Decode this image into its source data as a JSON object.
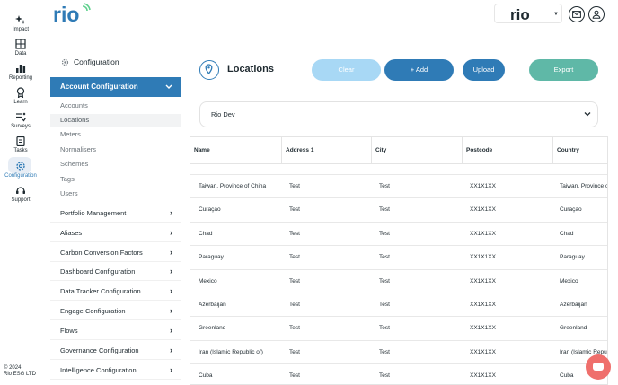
{
  "nav": {
    "items": [
      {
        "label": "Impact",
        "icon": "sparkle-icon"
      },
      {
        "label": "Data",
        "icon": "grid-icon"
      },
      {
        "label": "Reporting",
        "icon": "bar-chart-icon"
      },
      {
        "label": "Learn",
        "icon": "award-icon"
      },
      {
        "label": "Surveys",
        "icon": "list-check-icon"
      },
      {
        "label": "Tasks",
        "icon": "clipboard-icon"
      },
      {
        "label": "Configuration",
        "icon": "gear-icon",
        "active": true
      },
      {
        "label": "Support",
        "icon": "headset-icon"
      }
    ],
    "footer_line1": "© 2024",
    "footer_line2": "Rio ESG LTD"
  },
  "brand": {
    "logo_text": "rio",
    "org_logo_text": "rio",
    "accent": "#2f7bb6"
  },
  "config": {
    "title": "Configuration",
    "account_header": "Account Configuration",
    "account_items": [
      "Accounts",
      "Locations",
      "Meters",
      "Normalisers",
      "Schemes",
      "Tags",
      "Users"
    ],
    "selected_item": "Locations",
    "groups": [
      "Portfolio Management",
      "Aliases",
      "Carbon Conversion Factors",
      "Dashboard Configuration",
      "Data Tracker Configuration",
      "Engage Configuration",
      "Flows",
      "Governance Configuration",
      "Intelligence Configuration"
    ]
  },
  "main": {
    "title": "Locations",
    "buttons": {
      "clear": "Clear",
      "add": "+ Add",
      "upload": "Upload",
      "export": "Export"
    },
    "site": "Rio Dev"
  },
  "table": {
    "headers": [
      "Name",
      "Address 1",
      "City",
      "Postcode",
      "Country"
    ],
    "rows": [
      [
        "Taiwan, Province of China",
        "Test",
        "Test",
        "XX1X1XX",
        "Taiwan, Province of China"
      ],
      [
        "Curaçao",
        "Test",
        "Test",
        "XX1X1XX",
        "Curaçao"
      ],
      [
        "Chad",
        "Test",
        "Test",
        "XX1X1XX",
        "Chad"
      ],
      [
        "Paraguay",
        "Test",
        "Test",
        "XX1X1XX",
        "Paraguay"
      ],
      [
        "Mexico",
        "Test",
        "Test",
        "XX1X1XX",
        "Mexico"
      ],
      [
        "Azerbaijan",
        "Test",
        "Test",
        "XX1X1XX",
        "Azerbaijan"
      ],
      [
        "Greenland",
        "Test",
        "Test",
        "XX1X1XX",
        "Greenland"
      ],
      [
        "Iran (Islamic Republic of)",
        "Test",
        "Test",
        "XX1X1XX",
        "Iran (Islamic Republic of)"
      ],
      [
        "Cuba",
        "Test",
        "Test",
        "XX1X1XX",
        "Cuba"
      ]
    ]
  }
}
